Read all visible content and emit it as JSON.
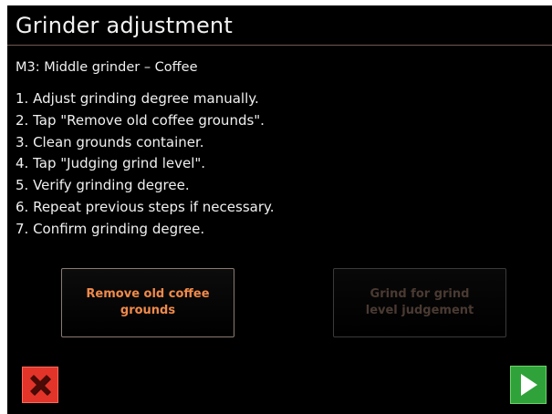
{
  "header": {
    "title": "Grinder adjustment"
  },
  "subtitle": "M3: Middle grinder – Coffee",
  "steps": [
    "1. Adjust grinding degree manually.",
    "2. Tap \"Remove old coffee grounds\".",
    "3. Clean grounds container.",
    "4. Tap \"Judging grind level\".",
    "5. Verify grinding degree.",
    "6. Repeat previous steps if necessary.",
    "7. Confirm grinding degree."
  ],
  "buttons": {
    "remove_old_grounds_label": "Remove old coffee grounds",
    "grind_for_judgement_label": "Grind for grind level judgement"
  },
  "footer": {
    "cancel_icon": "close-icon",
    "confirm_icon": "play-arrow-icon"
  },
  "colors": {
    "background": "#000000",
    "accent_orange": "#f08a4a",
    "disabled_text": "#4a3a32",
    "cancel_red": "#e3342a",
    "confirm_green": "#2fa33a"
  }
}
